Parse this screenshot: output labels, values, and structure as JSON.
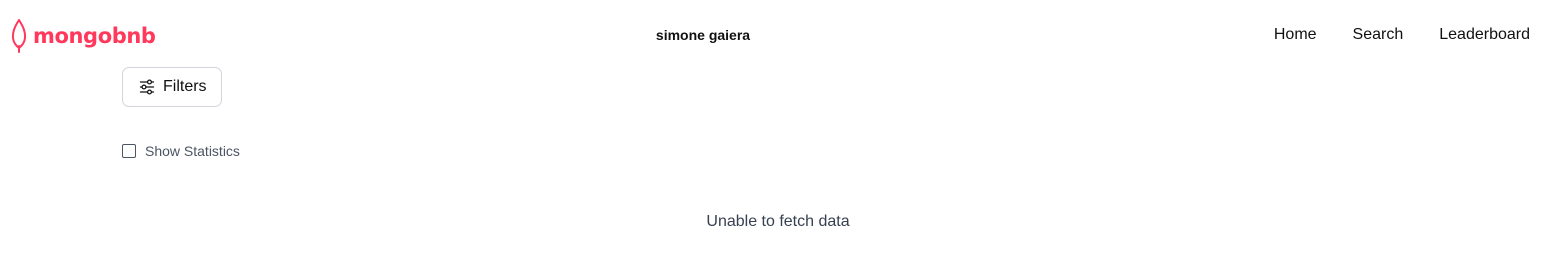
{
  "header": {
    "logo_text": "mongobnb",
    "user_name": "simone gaiera",
    "nav": {
      "home": "Home",
      "search": "Search",
      "leaderboard": "Leaderboard"
    }
  },
  "toolbar": {
    "filters_label": "Filters",
    "filters_icon": "sliders-icon"
  },
  "statistics": {
    "label": "Show Statistics",
    "checked": false
  },
  "main": {
    "message": "Unable to fetch data"
  },
  "colors": {
    "brand": "#ff385c",
    "text": "#111111",
    "muted": "#4b5563",
    "border": "#d1d5db"
  }
}
